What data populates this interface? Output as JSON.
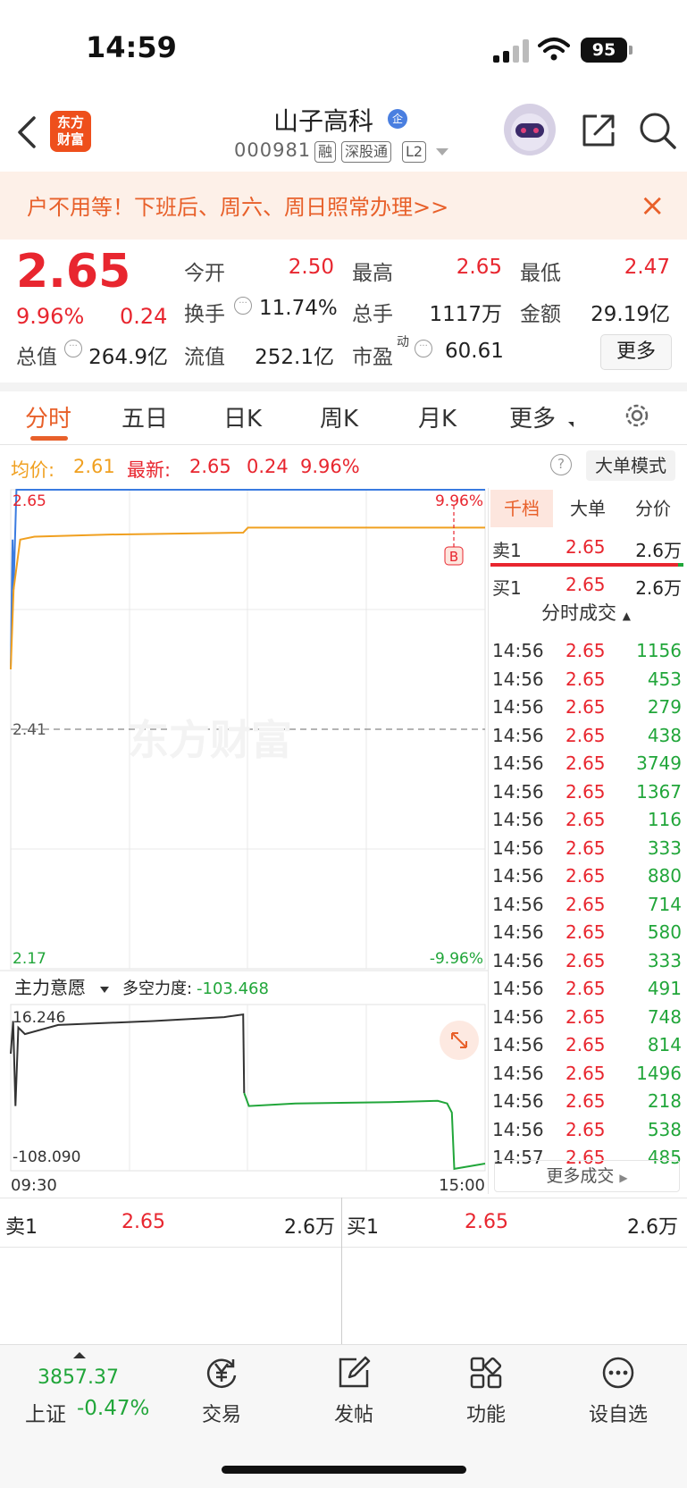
{
  "status_bar": {
    "time": "14:59",
    "battery": "95"
  },
  "header": {
    "logo_line1": "东方",
    "logo_line2": "财富",
    "stock_name": "山子高科",
    "cert_badge": "企",
    "stock_code": "000981",
    "tags": [
      "融",
      "深股通",
      "L2"
    ]
  },
  "banner": {
    "text": "户不用等！下班后、周六、周日照常办理>>"
  },
  "quote": {
    "price": "2.65",
    "change_pct": "9.96%",
    "change": "0.24",
    "open_label": "今开",
    "open": "2.50",
    "high_label": "最高",
    "high": "2.65",
    "low_label": "最低",
    "low": "2.47",
    "turnover_label": "换手",
    "turnover": "11.74%",
    "volume_label": "总手",
    "volume": "1117万",
    "amount_label": "金额",
    "amount": "29.19亿",
    "mktcap_label": "总值",
    "mktcap": "264.9亿",
    "float_label": "流值",
    "float": "252.1亿",
    "pe_label": "市盈",
    "pe_sup": "动",
    "pe": "60.61",
    "more_label": "更多"
  },
  "tabs": [
    "分时",
    "五日",
    "日K",
    "周K",
    "月K",
    "更多"
  ],
  "chart_header": {
    "avg_label": "均价:",
    "avg": "2.61",
    "latest_label": "最新:",
    "latest": "2.65",
    "change": "0.24",
    "change_pct": "9.96%",
    "mode_button": "大单模式"
  },
  "colors": {
    "up": "#e8262f",
    "down": "#21a63a",
    "accent": "#e8602a",
    "avg_line": "#f0a020",
    "price_line": "#3a7be0"
  },
  "chart_data": {
    "type": "line",
    "price_panel": {
      "y_top": "2.65",
      "y_mid": "2.41",
      "y_bottom": "2.17",
      "pct_top": "9.96%",
      "pct_bottom": "-9.96%",
      "ylim": [
        2.17,
        2.65
      ],
      "prev_close": 2.41,
      "watermark": "东方财富",
      "marker": "B",
      "series": [
        {
          "x": [
            0,
            0.004,
            0.006,
            0.012,
            0.02,
            0.5,
            0.51,
            1.0
          ],
          "values": [
            2.47,
            2.6,
            2.55,
            2.65,
            2.65,
            2.65,
            2.65,
            2.65
          ]
        },
        {
          "x": [
            0,
            0.006,
            0.02,
            0.05,
            0.2,
            0.49,
            0.5,
            0.75,
            1.0
          ],
          "values": [
            2.47,
            2.55,
            2.6,
            2.603,
            2.605,
            2.607,
            2.612,
            2.612,
            2.612
          ]
        }
      ]
    },
    "indicator_panel": {
      "selector": "主力意愿",
      "metric_label": "多空力度:",
      "metric_value": "-103.468",
      "y_top": "16.246",
      "y_bottom": "-108.090",
      "ylim": [
        -108.09,
        16.246
      ],
      "x_start": "09:30",
      "x_end": "15:00",
      "series": [
        {
          "name": "black",
          "x": [
            0,
            0.005,
            0.01,
            0.016,
            0.03,
            0.1,
            0.3,
            0.45,
            0.49,
            0.492
          ],
          "values": [
            -20,
            5,
            -60,
            0,
            -5,
            2,
            5,
            8,
            10,
            -50
          ]
        },
        {
          "name": "green",
          "x": [
            0.492,
            0.502,
            0.6,
            0.8,
            0.9,
            0.92,
            0.93,
            0.935,
            1.0
          ],
          "values": [
            -50,
            -60,
            -58,
            -57,
            -56,
            -58,
            -65,
            -108,
            -104
          ]
        }
      ]
    }
  },
  "side_panel": {
    "tabs": [
      "千档",
      "大单",
      "分价"
    ],
    "sell1_label": "卖1",
    "sell1_price": "2.65",
    "sell1_vol": "2.6万",
    "buy1_label": "买1",
    "buy1_price": "2.65",
    "buy1_vol": "2.6万",
    "ticks_title": "分时成交",
    "ticks": [
      {
        "time": "14:56",
        "price": "2.65",
        "vol": "1156"
      },
      {
        "time": "14:56",
        "price": "2.65",
        "vol": "453"
      },
      {
        "time": "14:56",
        "price": "2.65",
        "vol": "279"
      },
      {
        "time": "14:56",
        "price": "2.65",
        "vol": "438"
      },
      {
        "time": "14:56",
        "price": "2.65",
        "vol": "3749"
      },
      {
        "time": "14:56",
        "price": "2.65",
        "vol": "1367"
      },
      {
        "time": "14:56",
        "price": "2.65",
        "vol": "116"
      },
      {
        "time": "14:56",
        "price": "2.65",
        "vol": "333"
      },
      {
        "time": "14:56",
        "price": "2.65",
        "vol": "880"
      },
      {
        "time": "14:56",
        "price": "2.65",
        "vol": "714"
      },
      {
        "time": "14:56",
        "price": "2.65",
        "vol": "580"
      },
      {
        "time": "14:56",
        "price": "2.65",
        "vol": "333"
      },
      {
        "time": "14:56",
        "price": "2.65",
        "vol": "491"
      },
      {
        "time": "14:56",
        "price": "2.65",
        "vol": "748"
      },
      {
        "time": "14:56",
        "price": "2.65",
        "vol": "814"
      },
      {
        "time": "14:56",
        "price": "2.65",
        "vol": "1496"
      },
      {
        "time": "14:56",
        "price": "2.65",
        "vol": "218"
      },
      {
        "time": "14:56",
        "price": "2.65",
        "vol": "538"
      },
      {
        "time": "14:57",
        "price": "2.65",
        "vol": "485"
      }
    ],
    "more_deals": "更多成交"
  },
  "order_bar": {
    "sell_label": "卖1",
    "sell_price": "2.65",
    "sell_vol": "2.6万",
    "buy_label": "买1",
    "buy_price": "2.65",
    "buy_vol": "2.6万"
  },
  "bottom_nav": {
    "index_value": "3857.37",
    "index_name": "上证",
    "index_pct": "-0.47%",
    "items": [
      {
        "label": "交易",
        "icon": "yen-trade-icon"
      },
      {
        "label": "发帖",
        "icon": "compose-icon"
      },
      {
        "label": "功能",
        "icon": "grid-apps-icon"
      },
      {
        "label": "设自选",
        "icon": "more-dots-icon"
      }
    ]
  }
}
